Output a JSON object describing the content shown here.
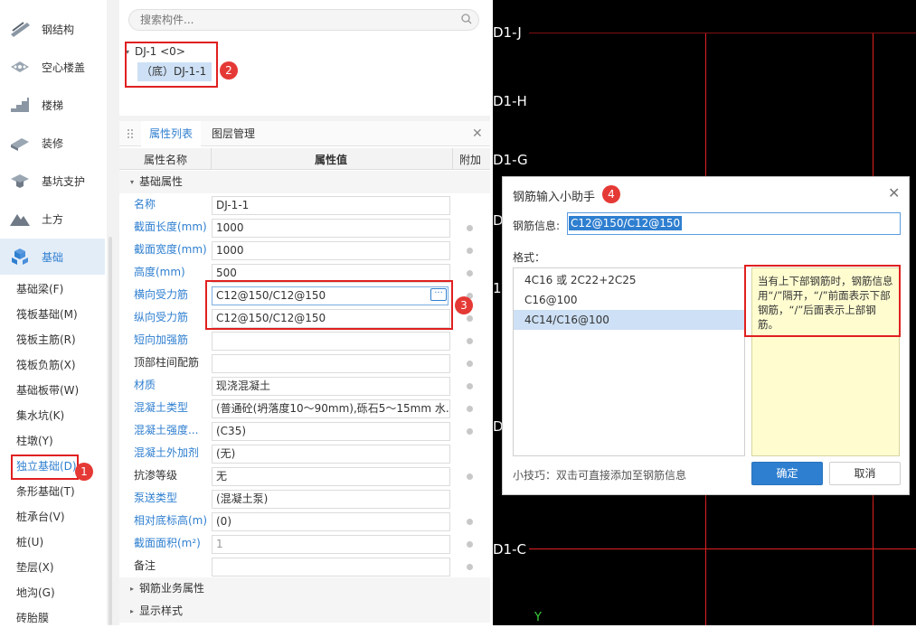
{
  "sidebar": {
    "categories": [
      {
        "label": "钢结构",
        "icon": "steel-structure-icon"
      },
      {
        "label": "空心楼盖",
        "icon": "hollow-slab-icon"
      },
      {
        "label": "楼梯",
        "icon": "stairs-icon"
      },
      {
        "label": "装修",
        "icon": "decoration-icon"
      },
      {
        "label": "基坑支护",
        "icon": "pit-support-icon"
      },
      {
        "label": "土方",
        "icon": "earthwork-icon"
      },
      {
        "label": "基础",
        "icon": "foundation-icon"
      }
    ],
    "sub_items": [
      {
        "label": "基础梁(F)"
      },
      {
        "label": "筏板基础(M)"
      },
      {
        "label": "筏板主筋(R)"
      },
      {
        "label": "筏板负筋(X)"
      },
      {
        "label": "基础板带(W)"
      },
      {
        "label": "集水坑(K)"
      },
      {
        "label": "柱墩(Y)"
      },
      {
        "label": "独立基础(D)"
      },
      {
        "label": "条形基础(T)"
      },
      {
        "label": "桩承台(V)"
      },
      {
        "label": "桩(U)"
      },
      {
        "label": "垫层(X)"
      },
      {
        "label": "地沟(G)"
      },
      {
        "label": "砖胎膜"
      }
    ]
  },
  "tree": {
    "search_placeholder": "搜索构件...",
    "root": "DJ-1 <0>",
    "child": "（底）DJ-1-1"
  },
  "props": {
    "tab_active": "属性列表",
    "tab_other": "图层管理",
    "col_name": "属性名称",
    "col_value": "属性值",
    "col_extra": "附加",
    "group_basic": "基础属性",
    "rows": [
      {
        "name": "名称",
        "value": "DJ-1-1"
      },
      {
        "name": "截面长度(mm)",
        "value": "1000"
      },
      {
        "name": "截面宽度(mm)",
        "value": "1000"
      },
      {
        "name": "高度(mm)",
        "value": "500"
      },
      {
        "name": "横向受力筋",
        "value": "C12@150/C12@150"
      },
      {
        "name": "纵向受力筋",
        "value": "C12@150/C12@150"
      },
      {
        "name": "短向加强筋",
        "value": ""
      },
      {
        "name": "顶部柱间配筋",
        "value": ""
      },
      {
        "name": "材质",
        "value": "现浇混凝土"
      },
      {
        "name": "混凝土类型",
        "value": "(普通砼(坍落度10～90mm),砾石5～15mm 水..."
      },
      {
        "name": "混凝土强度...",
        "value": "(C35)"
      },
      {
        "name": "混凝土外加剂",
        "value": "(无)"
      },
      {
        "name": "抗渗等级",
        "value": "无"
      },
      {
        "name": "泵送类型",
        "value": "(混凝土泵)"
      },
      {
        "name": "相对底标高(m)",
        "value": "(0)"
      },
      {
        "name": "截面面积(m²)",
        "value": "1"
      },
      {
        "name": "备注",
        "value": ""
      }
    ],
    "group_rebar": "钢筋业务属性",
    "group_display": "显示样式"
  },
  "cad": {
    "axis_labels": [
      "D1-J",
      "D1-H",
      "D1-G",
      "D",
      "1",
      "D",
      "D1-C"
    ],
    "y_label": "Y"
  },
  "dialog": {
    "title": "钢筋输入小助手",
    "info_label": "钢筋信息:",
    "info_value": "C12@150/C12@150",
    "format_label": "格式：",
    "formats": [
      "4C16 或 2C22+2C25",
      "C16@100",
      "4C14/C16@100"
    ],
    "hint": "当有上下部钢筋时，钢筋信息用“/”隔开，“/”前面表示下部钢筋，“/”后面表示上部钢筋。",
    "tip": "小技巧：双击可直接添加至钢筋信息",
    "ok": "确定",
    "cancel": "取消"
  },
  "badges": [
    "1",
    "2",
    "3",
    "4"
  ],
  "colors": {
    "accent": "#2f7fd0",
    "badge": "#e53935",
    "hint_bg": "#fffdd0",
    "cad_bg": "#000000"
  }
}
